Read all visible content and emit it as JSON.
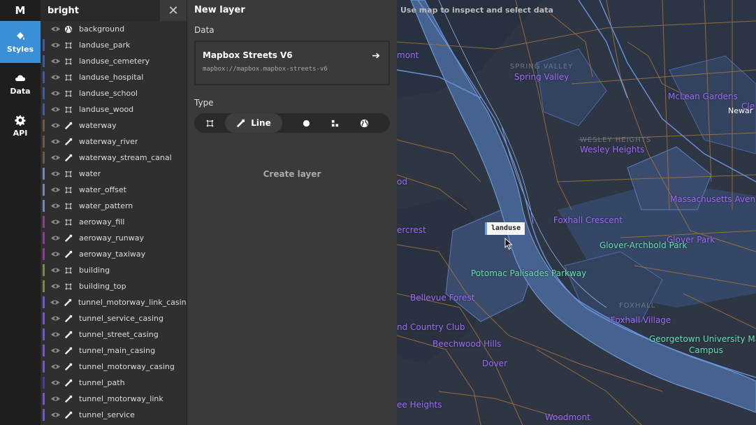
{
  "nav": {
    "logo": "M",
    "items": [
      {
        "label": "Styles",
        "icon": "paint-bucket-icon",
        "active": true
      },
      {
        "label": "Data",
        "icon": "cloud-icon",
        "active": false
      },
      {
        "label": "API",
        "icon": "gear-icon",
        "active": false
      }
    ]
  },
  "style": {
    "name": "bright",
    "close_icon": "close-icon"
  },
  "layers": [
    {
      "name": "background",
      "type": "background",
      "color": null
    },
    {
      "name": "landuse_park",
      "type": "fill",
      "color": "#3f5c9a"
    },
    {
      "name": "landuse_cemetery",
      "type": "fill",
      "color": "#3f5c9a"
    },
    {
      "name": "landuse_hospital",
      "type": "fill",
      "color": "#3f5c9a"
    },
    {
      "name": "landuse_school",
      "type": "fill",
      "color": "#3f5c9a"
    },
    {
      "name": "landuse_wood",
      "type": "fill",
      "color": "#3f5c9a"
    },
    {
      "name": "waterway",
      "type": "line",
      "color": "#6a5a44"
    },
    {
      "name": "waterway_river",
      "type": "line",
      "color": "#6a5a44"
    },
    {
      "name": "waterway_stream_canal",
      "type": "line",
      "color": "#6a5a44"
    },
    {
      "name": "water",
      "type": "fill",
      "color": "#7488ad"
    },
    {
      "name": "water_offset",
      "type": "fill",
      "color": "#7488ad"
    },
    {
      "name": "water_pattern",
      "type": "fill",
      "color": "#7488ad"
    },
    {
      "name": "aeroway_fill",
      "type": "fill",
      "color": "#8a3f8c"
    },
    {
      "name": "aeroway_runway",
      "type": "line",
      "color": "#8a3f8c"
    },
    {
      "name": "aeroway_taxiway",
      "type": "line",
      "color": "#8a3f8c"
    },
    {
      "name": "building",
      "type": "fill",
      "color": "#7a8a4a"
    },
    {
      "name": "building_top",
      "type": "fill",
      "color": "#7a8a4a"
    },
    {
      "name": "tunnel_motorway_link_casing",
      "type": "line",
      "color": "#7a55c9"
    },
    {
      "name": "tunnel_service_casing",
      "type": "line",
      "color": "#7a55c9"
    },
    {
      "name": "tunnel_street_casing",
      "type": "line",
      "color": "#7a55c9"
    },
    {
      "name": "tunnel_main_casing",
      "type": "line",
      "color": "#7a55c9"
    },
    {
      "name": "tunnel_motorway_casing",
      "type": "line",
      "color": "#7a55c9"
    },
    {
      "name": "tunnel_path",
      "type": "line",
      "color": "#4a3a9a"
    },
    {
      "name": "tunnel_motorway_link",
      "type": "line",
      "color": "#7a55c9"
    },
    {
      "name": "tunnel_service",
      "type": "line",
      "color": "#7a55c9"
    }
  ],
  "panel": {
    "title": "New layer",
    "data_label": "Data",
    "source_name": "Mapbox Streets V6",
    "source_url": "mapbox://mapbox.mapbox-streets-v6",
    "type_label": "Type",
    "types": [
      {
        "id": "fill",
        "label": "",
        "icon": "fill-icon",
        "active": false
      },
      {
        "id": "line",
        "label": "Line",
        "icon": "line-icon",
        "active": true
      },
      {
        "id": "circle",
        "label": "",
        "icon": "circle-icon",
        "active": false
      },
      {
        "id": "symbol",
        "label": "",
        "icon": "symbol-icon",
        "active": false
      },
      {
        "id": "background",
        "label": "",
        "icon": "globe-icon",
        "active": false
      }
    ],
    "create_label": "Create layer"
  },
  "map": {
    "hint": "Use map to inspect and select data",
    "tooltip": "landuse",
    "labels": [
      {
        "text": "Spring Valley",
        "style": "purple"
      },
      {
        "text": "McLean Gardens",
        "style": "purple"
      },
      {
        "text": "Wesley Heights",
        "style": "purple"
      },
      {
        "text": "Massachusetts Avenu",
        "style": "purple"
      },
      {
        "text": "Foxhall Crescent",
        "style": "purple"
      },
      {
        "text": "Glover Park",
        "style": "purple"
      },
      {
        "text": "Glover-Archbold Park",
        "style": "teal"
      },
      {
        "text": "Potomac Palisades Parkway",
        "style": "teal"
      },
      {
        "text": "Bellevue Forest",
        "style": "purple"
      },
      {
        "text": "Foxhall Village",
        "style": "purple"
      },
      {
        "text": "nd Country Club",
        "style": "purple"
      },
      {
        "text": "Georgetown University Ma",
        "style": "teal"
      },
      {
        "text": "Campus",
        "style": "teal"
      },
      {
        "text": "Beechwood Hills",
        "style": "purple"
      },
      {
        "text": "Dover",
        "style": "purple"
      },
      {
        "text": "ee Heights",
        "style": "purple"
      },
      {
        "text": "Woodmont",
        "style": "purple"
      },
      {
        "text": "mont",
        "style": "purple"
      },
      {
        "text": "ercrest",
        "style": "purple"
      },
      {
        "text": "od",
        "style": "purple"
      },
      {
        "text": "Cle",
        "style": "purple"
      },
      {
        "text": "Newar",
        "style": "white"
      },
      {
        "text": "SPRING VALLEY",
        "style": "dim"
      },
      {
        "text": "WESLEY HEIGHTS",
        "style": "dim"
      },
      {
        "text": "FOXHALL",
        "style": "dim"
      },
      {
        "text": "VILLAGE",
        "style": "dim"
      }
    ]
  }
}
